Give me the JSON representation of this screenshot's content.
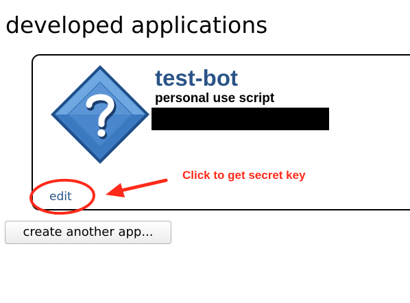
{
  "section": {
    "heading": "developed applications",
    "create_button_label": "create another app..."
  },
  "app": {
    "name": "test-bot",
    "type": "personal use script",
    "icon": "question-mark-diamond-icon",
    "edit_label": "edit"
  },
  "annotation": {
    "text": "Click to get secret key",
    "color": "#ff2a1a"
  },
  "colors": {
    "link": "#2a5487",
    "annotation": "#ff2a1a"
  }
}
